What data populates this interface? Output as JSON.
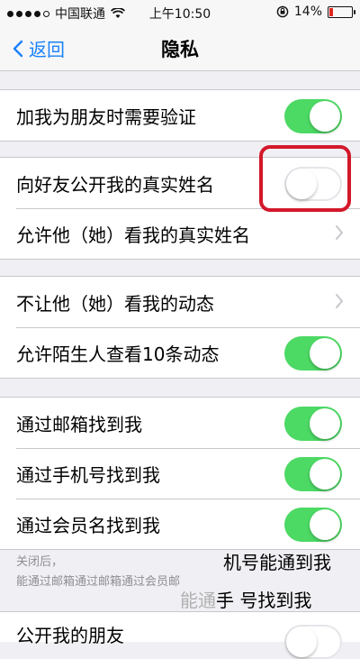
{
  "status_bar": {
    "carrier": "中国联通",
    "time": "上午10:50",
    "battery": "14%",
    "battery_color": "#e0261e"
  },
  "nav": {
    "back_label": "返回",
    "title": "隐私"
  },
  "groups": [
    {
      "rows": [
        {
          "label": "加我为朋友时需要验证",
          "control": "toggle",
          "on": true
        }
      ]
    },
    {
      "rows": [
        {
          "label": "向好友公开我的真实姓名",
          "control": "toggle",
          "on": false,
          "highlighted": true
        },
        {
          "label": "允许他（她）看我的真实姓名",
          "control": "chevron"
        }
      ]
    },
    {
      "rows": [
        {
          "label": "不让他（她）看我的动态",
          "control": "chevron"
        },
        {
          "label": "允许陌生人查看10条动态",
          "control": "toggle",
          "on": true
        }
      ]
    },
    {
      "rows": [
        {
          "label": "通过邮箱找到我",
          "control": "toggle",
          "on": true
        },
        {
          "label": "通过手机号找到我",
          "control": "toggle",
          "on": true
        },
        {
          "label": "通过会员名找到我",
          "control": "toggle",
          "on": true
        }
      ]
    }
  ],
  "footer": {
    "note_line1": "关闭后，",
    "note_line2": "能通过邮箱通过邮箱通过会员邮",
    "overlay_1": "机号能通到我",
    "overlay_2_ghost": "能通",
    "overlay_2": "手 号找到我"
  },
  "partial_row": {
    "label": "公开我的朋友"
  },
  "colors": {
    "accent": "#1a82fb",
    "toggle_on": "#4cd964",
    "highlight": "#d3182a"
  },
  "icons": [
    "signal-dots-icon",
    "wifi-icon",
    "lock-rotation-icon",
    "battery-icon",
    "back-chevron-icon",
    "chevron-right-icon"
  ]
}
